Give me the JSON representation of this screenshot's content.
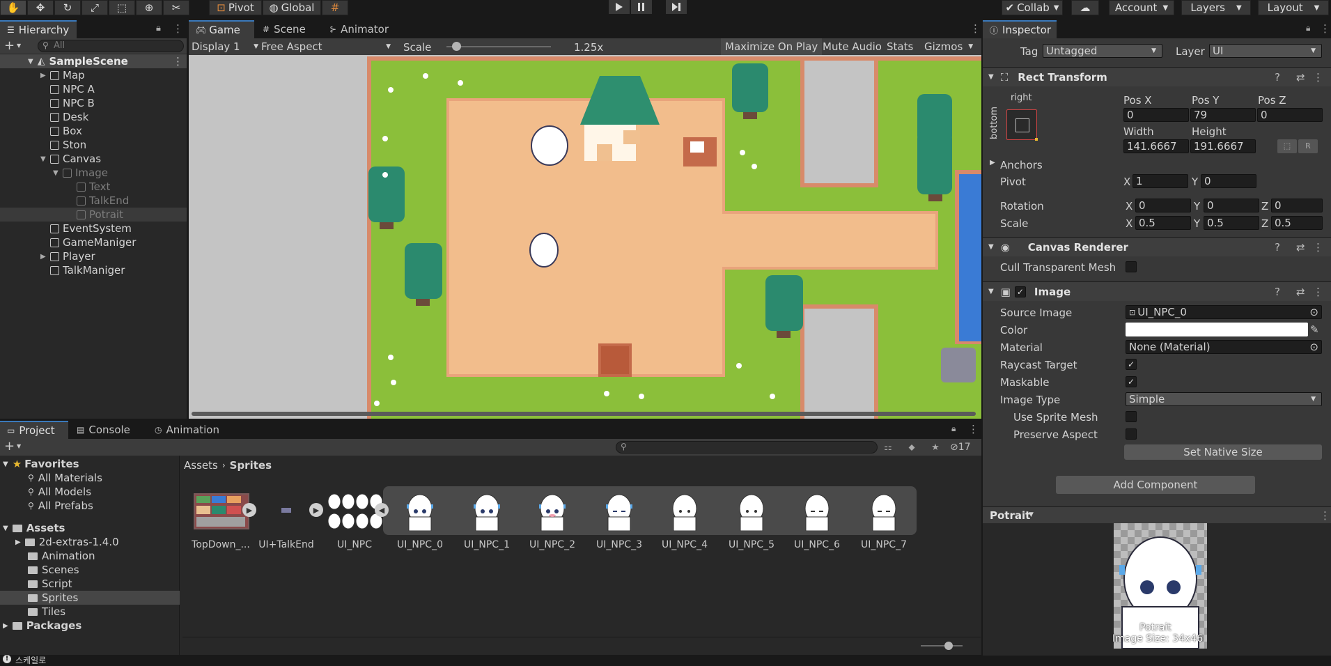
{
  "toolbar": {
    "pivot": "Pivot",
    "global": "Global",
    "collab": "Collab",
    "account": "Account",
    "layers": "Layers",
    "layout": "Layout"
  },
  "hierarchy": {
    "tab": "Hierarchy",
    "search_placeholder": "All",
    "scene": "SampleScene",
    "items": [
      {
        "label": "Map"
      },
      {
        "label": "NPC A"
      },
      {
        "label": "NPC B"
      },
      {
        "label": "Desk"
      },
      {
        "label": "Box"
      },
      {
        "label": "Ston"
      },
      {
        "label": "Canvas"
      },
      {
        "label": "Image"
      },
      {
        "label": "Text"
      },
      {
        "label": "TalkEnd"
      },
      {
        "label": "Potrait"
      },
      {
        "label": "EventSystem"
      },
      {
        "label": "GameManiger"
      },
      {
        "label": "Player"
      },
      {
        "label": "TalkManiger"
      }
    ]
  },
  "game": {
    "tabs": [
      "Game",
      "Scene",
      "Animator"
    ],
    "display": "Display 1",
    "aspect": "Free Aspect",
    "scale_label": "Scale",
    "scale_value": "1.25x",
    "maximize": "Maximize On Play",
    "mute": "Mute Audio",
    "stats": "Stats",
    "gizmos": "Gizmos"
  },
  "inspector": {
    "tab": "Inspector",
    "tag_label": "Tag",
    "tag_value": "Untagged",
    "layer_label": "Layer",
    "layer_value": "UI",
    "rect_transform": "Rect Transform",
    "anchor_h": "right",
    "anchor_v": "bottom",
    "pos_x_label": "Pos X",
    "pos_y_label": "Pos Y",
    "pos_z_label": "Pos Z",
    "pos_x": "0",
    "pos_y": "79",
    "pos_z": "0",
    "width_label": "Width",
    "height_label": "Height",
    "width": "141.6667",
    "height": "191.6667",
    "anchors": "Anchors",
    "pivot_label": "Pivot",
    "pivot_x": "1",
    "pivot_y": "0",
    "rotation_label": "Rotation",
    "rot_x": "0",
    "rot_y": "0",
    "rot_z": "0",
    "scale_label": "Scale",
    "scale_x": "0.5",
    "scale_y": "0.5",
    "scale_z": "0.5",
    "x": "X",
    "y": "Y",
    "z": "Z",
    "canvas_renderer": "Canvas Renderer",
    "cull": "Cull Transparent Mesh",
    "image": "Image",
    "source_image_label": "Source Image",
    "source_image": "UI_NPC_0",
    "color_label": "Color",
    "material_label": "Material",
    "material": "None (Material)",
    "raycast": "Raycast Target",
    "maskable": "Maskable",
    "image_type_label": "Image Type",
    "image_type": "Simple",
    "use_sprite_mesh": "Use Sprite Mesh",
    "preserve_aspect": "Preserve Aspect",
    "set_native": "Set Native Size",
    "add_component": "Add Component",
    "preview_title": "Potrait",
    "preview_name": "Potrait",
    "preview_size": "Image Size: 34x46"
  },
  "project": {
    "tabs": [
      "Project",
      "Console",
      "Animation"
    ],
    "hidden_count": "17",
    "favorites": "Favorites",
    "fav_items": [
      "All Materials",
      "All Models",
      "All Prefabs"
    ],
    "assets": "Assets",
    "folders": [
      "2d-extras-1.4.0",
      "Animation",
      "Scenes",
      "Script",
      "Sprites",
      "Tiles"
    ],
    "packages": "Packages",
    "breadcrumb_root": "Assets",
    "breadcrumb_current": "Sprites",
    "asset_items": [
      "TopDown_...",
      "UI+TalkEnd",
      "UI_NPC",
      "UI_NPC_0",
      "UI_NPC_1",
      "UI_NPC_2",
      "UI_NPC_3",
      "UI_NPC_4",
      "UI_NPC_5",
      "UI_NPC_6",
      "UI_NPC_7"
    ]
  },
  "status": {
    "text": "스케일로"
  },
  "colors": {
    "accent": "#3a79bb",
    "grass": "#8bbf3a",
    "dirt": "#f2bd8c",
    "water": "#3a7bd5"
  }
}
